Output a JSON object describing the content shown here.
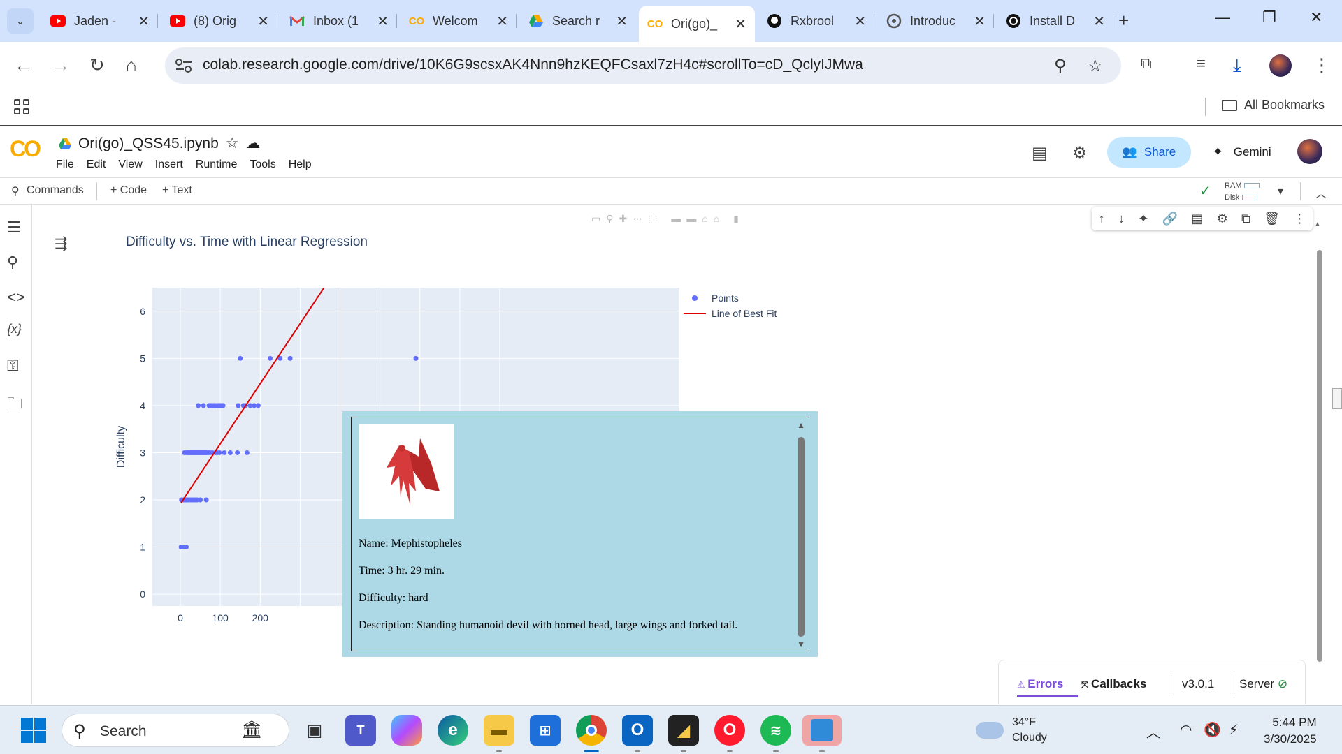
{
  "browser": {
    "tabs": [
      {
        "title": "Jaden -",
        "favicon": "youtube-icon",
        "color": "#ff0000"
      },
      {
        "title": "(8) Orig",
        "favicon": "youtube-icon",
        "color": "#ff0000"
      },
      {
        "title": "Inbox (1",
        "favicon": "gmail-icon",
        "color": "#ea4335"
      },
      {
        "title": "Welcom",
        "favicon": "colab-icon",
        "color": "#f9ab00"
      },
      {
        "title": "Search r",
        "favicon": "drive-icon",
        "color": "#1fa463"
      },
      {
        "title": "Ori(go)_",
        "favicon": "colab-icon",
        "color": "#f9ab00",
        "active": true
      },
      {
        "title": "Rxbrool",
        "favicon": "github-icon",
        "color": "#111111"
      },
      {
        "title": "Introduc",
        "favicon": "openai-icon",
        "color": "#555555"
      },
      {
        "title": "Install D",
        "favicon": "openai-icon",
        "color": "#111111"
      }
    ],
    "url": "colab.research.google.com/drive/10K6G9scsxAK4Nnn9hzKEQFCsaxl7zH4c#scrollTo=cD_QclyIJMwa",
    "bookmarks_label": "All Bookmarks"
  },
  "colab": {
    "notebook_title": "Ori(go)_QSS45.ipynb",
    "menu": [
      "File",
      "Edit",
      "View",
      "Insert",
      "Runtime",
      "Tools",
      "Help"
    ],
    "share_label": "Share",
    "gemini_label": "Gemini",
    "toolbar": {
      "commands": "Commands",
      "code": "+ Code",
      "text": "+ Text",
      "ram": "RAM",
      "disk": "Disk"
    }
  },
  "chart_data": {
    "type": "scatter",
    "title": "Difficulty vs. Time with Linear Regression",
    "xlabel": "",
    "ylabel": "Difficulty",
    "xlim": [
      -70,
      1250
    ],
    "ylim": [
      -0.25,
      6.5
    ],
    "x_ticks": [
      "0",
      "100",
      "200"
    ],
    "y_ticks": [
      "0",
      "1",
      "2",
      "3",
      "4",
      "5",
      "6"
    ],
    "grid": true,
    "legend_position": "top-right",
    "series": [
      {
        "name": "Points",
        "color": "#636efa",
        "points": [
          [
            2,
            1
          ],
          [
            4,
            1
          ],
          [
            6,
            1
          ],
          [
            8,
            1
          ],
          [
            10,
            1
          ],
          [
            12,
            1
          ],
          [
            15,
            1
          ],
          [
            3,
            2
          ],
          [
            6,
            2
          ],
          [
            9,
            2
          ],
          [
            12,
            2
          ],
          [
            15,
            2
          ],
          [
            18,
            2
          ],
          [
            22,
            2
          ],
          [
            26,
            2
          ],
          [
            30,
            2
          ],
          [
            34,
            2
          ],
          [
            38,
            2
          ],
          [
            42,
            2
          ],
          [
            50,
            2
          ],
          [
            65,
            2
          ],
          [
            10,
            3
          ],
          [
            15,
            3
          ],
          [
            18,
            3
          ],
          [
            21,
            3
          ],
          [
            24,
            3
          ],
          [
            27,
            3
          ],
          [
            30,
            3
          ],
          [
            33,
            3
          ],
          [
            36,
            3
          ],
          [
            39,
            3
          ],
          [
            42,
            3
          ],
          [
            45,
            3
          ],
          [
            48,
            3
          ],
          [
            51,
            3
          ],
          [
            54,
            3
          ],
          [
            57,
            3
          ],
          [
            60,
            3
          ],
          [
            63,
            3
          ],
          [
            66,
            3
          ],
          [
            70,
            3
          ],
          [
            74,
            3
          ],
          [
            80,
            3
          ],
          [
            88,
            3
          ],
          [
            92,
            3
          ],
          [
            98,
            3
          ],
          [
            110,
            3
          ],
          [
            125,
            3
          ],
          [
            143,
            3
          ],
          [
            167,
            3
          ],
          [
            45,
            4
          ],
          [
            58,
            4
          ],
          [
            72,
            4
          ],
          [
            76,
            4
          ],
          [
            80,
            4
          ],
          [
            84,
            4
          ],
          [
            88,
            4
          ],
          [
            94,
            4
          ],
          [
            98,
            4
          ],
          [
            102,
            4
          ],
          [
            107,
            4
          ],
          [
            145,
            4
          ],
          [
            158,
            4
          ],
          [
            163,
            4
          ],
          [
            175,
            4
          ],
          [
            185,
            4
          ],
          [
            195,
            4
          ],
          [
            150,
            5
          ],
          [
            225,
            5
          ],
          [
            250,
            5
          ],
          [
            275,
            5
          ],
          [
            590,
            5
          ]
        ]
      },
      {
        "name": "Line of Best Fit",
        "color": "#e00000",
        "line": [
          [
            2,
            1.94
          ],
          [
            360,
            6.5
          ]
        ]
      }
    ]
  },
  "tooltip": {
    "name": "Name: Mephistopheles",
    "time": "Time: 3 hr. 29 min.",
    "difficulty": "Difficulty: hard",
    "description": "Description: Standing humanoid devil with horned head, large wings and forked tail."
  },
  "dash_footer": {
    "errors": "Errors",
    "callbacks": "Callbacks",
    "version": "v3.0.1",
    "server": "Server"
  },
  "taskbar": {
    "search_label": "Search",
    "weather_temp": "34°F",
    "weather_desc": "Cloudy",
    "time": "5:44 PM",
    "date": "3/30/2025"
  }
}
